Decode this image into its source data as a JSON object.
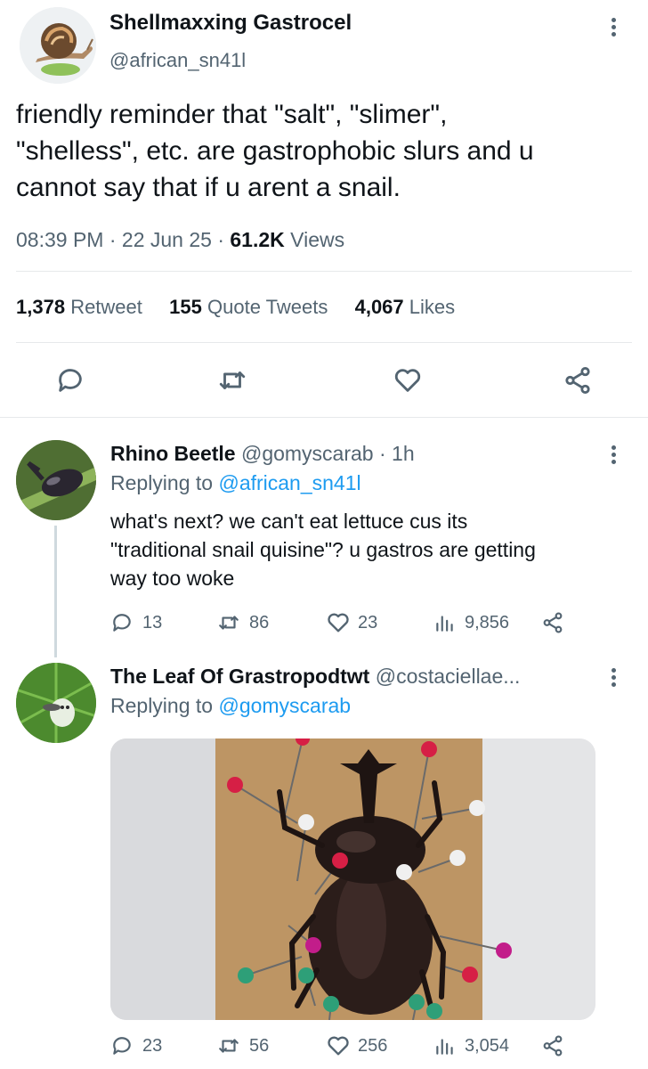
{
  "main_tweet": {
    "author_name": "Shellmaxxing Gastrocel",
    "author_handle": "@african_sn41l",
    "text_line1": "friendly reminder that \"salt\", \"slimer\",",
    "text_line2": "\"shelless\", etc. are gastrophobic slurs and u",
    "text_line3": "cannot say that if u arent a snail.",
    "time": "08:39 PM",
    "date": "22 Jun 25",
    "views_count": "61.2K",
    "views_label": "Views",
    "retweets_count": "1,378",
    "retweets_label": "Retweet",
    "quotes_count": "155",
    "quotes_label": "Quote Tweets",
    "likes_count": "4,067",
    "likes_label": "Likes"
  },
  "replies": [
    {
      "author_name": "Rhino Beetle",
      "author_handle": "@gomyscarab",
      "time": "1h",
      "replying_prefix": "Replying to",
      "replying_to": "@african_sn41l",
      "text_line1": "what's next? we can't eat lettuce cus its",
      "text_line2": "\"traditional snail quisine\"? u gastros are getting",
      "text_line3": "way too woke",
      "reply_count": "13",
      "retweet_count": "86",
      "like_count": "23",
      "view_count": "9,856"
    },
    {
      "author_name": "The Leaf Of Grastropodtwt",
      "author_handle": "@costaciellae...",
      "replying_prefix": "Replying to",
      "replying_to": "@gomyscarab",
      "reply_count": "23",
      "retweet_count": "56",
      "like_count": "256",
      "view_count": "3,054"
    }
  ],
  "icons": {
    "reply": "reply-icon",
    "retweet": "retweet-icon",
    "like": "heart-icon",
    "share": "share-icon",
    "views": "views-icon",
    "more": "more-icon"
  },
  "colors": {
    "accent": "#1d9bf0",
    "secondary_text": "#536471",
    "primary_text": "#0f1419"
  }
}
